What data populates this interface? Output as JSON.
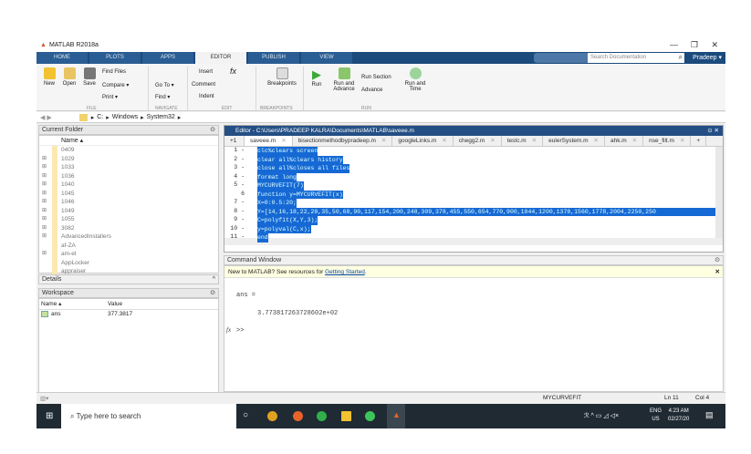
{
  "window": {
    "title": "MATLAB R2018a",
    "controls": [
      "—",
      "❐",
      "✕"
    ]
  },
  "ribbon_tabs": [
    "HOME",
    "PLOTS",
    "APPS",
    "EDITOR",
    "PUBLISH",
    "VIEW"
  ],
  "active_tab": "EDITOR",
  "search": {
    "placeholder": "Search Documentation"
  },
  "user": "Pradeep ▾",
  "ribbon": {
    "file": {
      "new": "New",
      "open": "Open",
      "save": "Save",
      "find_files": "Find Files",
      "compare": "Compare ▾",
      "print": "Print ▾",
      "label": "FILE"
    },
    "navigate": {
      "goto": "Go To ▾",
      "find": "Find ▾",
      "label": "NAVIGATE"
    },
    "edit": {
      "insert": "Insert",
      "comment": "Comment",
      "indent": "Indent",
      "label": "EDIT"
    },
    "breakpoints": {
      "btn": "Breakpoints",
      "label": "BREAKPOINTS"
    },
    "run": {
      "run": "Run",
      "run_advance": "Run and Advance",
      "run_section": "Run Section",
      "advance": "Advance",
      "run_time": "Run and Time",
      "label": "RUN"
    }
  },
  "address": {
    "path": [
      "C:",
      "Windows",
      "System32"
    ]
  },
  "current_folder": {
    "title": "Current Folder",
    "col": "Name ▴",
    "items": [
      {
        "name": "0409",
        "expand": false
      },
      {
        "name": "1029",
        "expand": true
      },
      {
        "name": "1033",
        "expand": true
      },
      {
        "name": "1036",
        "expand": true
      },
      {
        "name": "1040",
        "expand": true
      },
      {
        "name": "1045",
        "expand": true
      },
      {
        "name": "1046",
        "expand": true
      },
      {
        "name": "1049",
        "expand": true
      },
      {
        "name": "1055",
        "expand": true
      },
      {
        "name": "3082",
        "expand": true
      },
      {
        "name": "AdvancedInstallers",
        "expand": true
      },
      {
        "name": "af-ZA",
        "expand": false
      },
      {
        "name": "am-et",
        "expand": true
      },
      {
        "name": "AppLocker",
        "expand": false
      },
      {
        "name": "appraiser",
        "expand": false
      }
    ]
  },
  "details": {
    "title": "Details"
  },
  "workspace": {
    "title": "Workspace",
    "cols": [
      "Name ▴",
      "Value"
    ],
    "rows": [
      {
        "name": "ans",
        "value": "377.3817"
      }
    ]
  },
  "editor": {
    "title": "Editor - C:\\Users\\PRADEEP KALRA\\Documents\\MATLAB\\saveee.m",
    "tabs": [
      "saveee.m",
      "bisectionmethodbypradeep.m",
      "googleLinks.m",
      "chegg2.m",
      "testc.m",
      "eulerSystem.m",
      "ahk.m",
      "nse_filt.m"
    ],
    "lines": [
      "clc%clears screen",
      "clear all%clears history",
      "close all%closes all files",
      "format long",
      "MYCURVEFIT(7)",
      "function y=MYCURVEFIT(x)",
      "X=0:0.5:20;",
      "Y=[14,16,18,22,28,35,50,68,90,117,154,200,248,309,378,455,550,654,770,900,1044,1200,1378,1560,1778,2004,2250,250",
      "C=polyfit(X,Y,3);",
      "y=polyval(C,x);",
      "end"
    ],
    "line_numbers": [
      "1 -",
      "2 -",
      "3 -",
      "4 -",
      "5 -",
      "6",
      "7 -",
      "8 -",
      "9 -",
      "10 -",
      "11 -"
    ]
  },
  "command_window": {
    "title": "Command Window",
    "banner": "New to MATLAB? See resources for ",
    "banner_link": "Getting Started",
    "banner_end": ".",
    "output_var": "ans =",
    "output_val": "3.773817263728602e+02",
    "prompt": ">>"
  },
  "status": {
    "function": "MYCURVEFIT",
    "ln": "Ln  11",
    "col": "Col  4"
  },
  "taskbar": {
    "search": "Type here to search",
    "lang1": "ENG",
    "lang2": "US",
    "time": "4:23 AM",
    "date": "02/27/20"
  },
  "colors": {
    "tabstrip": "#1b4a7c",
    "selection": "#1669d4",
    "editor_title": "#244f85",
    "banner": "#ffffe1"
  }
}
